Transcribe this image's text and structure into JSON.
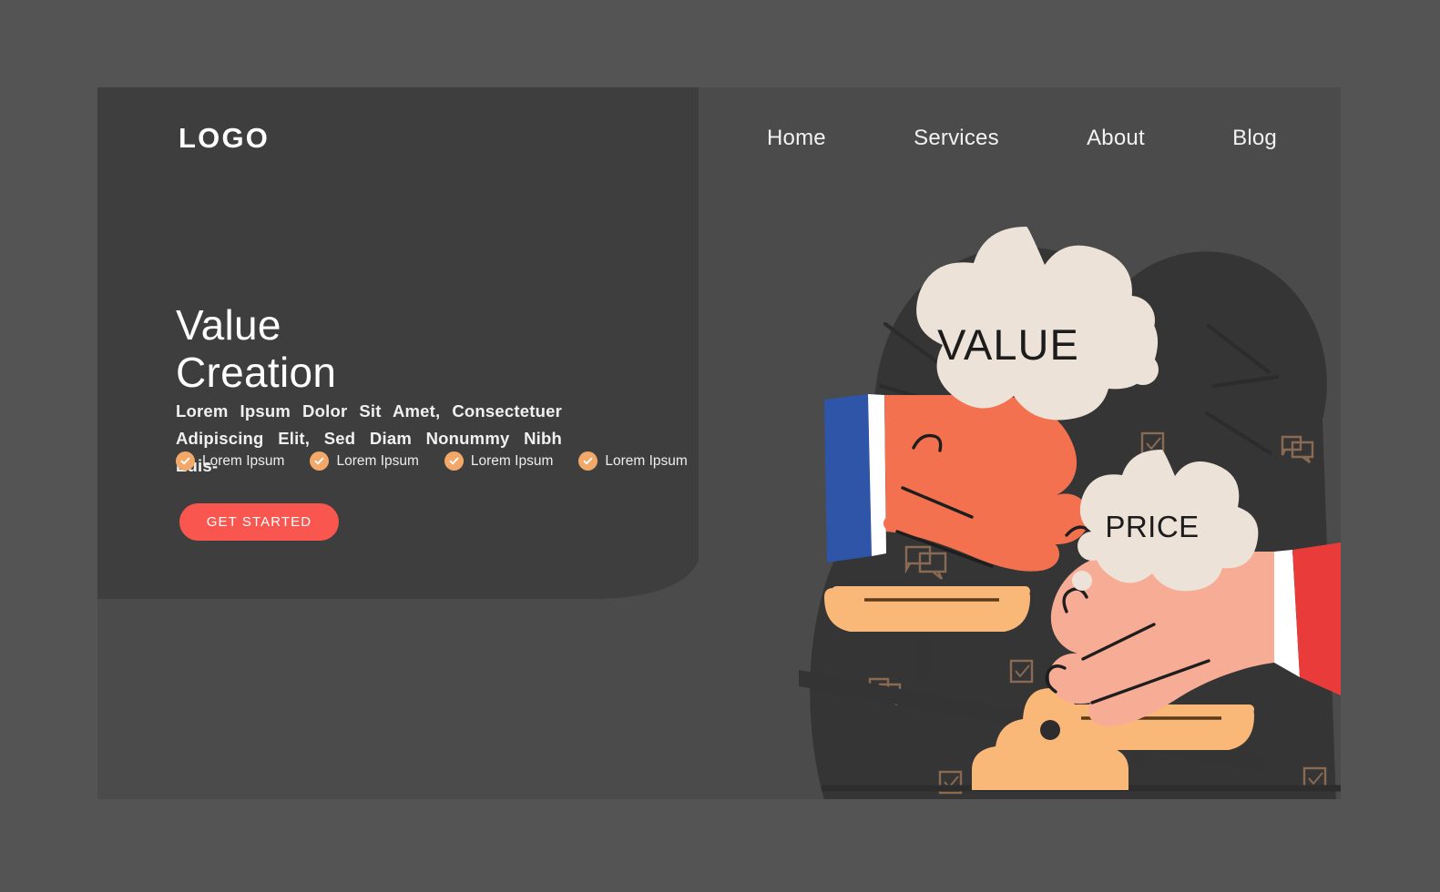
{
  "page": {
    "background_outer": "#545454",
    "card_background": "#3e3e3e"
  },
  "header": {
    "logo": "LOGO",
    "nav": [
      {
        "label": "Home"
      },
      {
        "label": "Services"
      },
      {
        "label": "About"
      },
      {
        "label": "Blog"
      }
    ]
  },
  "hero": {
    "headline_line1": "Value",
    "headline_line2": "Creation",
    "subcopy": "Lorem Ipsum Dolor Sit Amet, Consectetuer Adipiscing Elit, Sed Diam Nonummy Nibh Euis-",
    "features": [
      {
        "label": "Lorem Ipsum",
        "icon": "check-circle-icon"
      },
      {
        "label": "Lorem Ipsum",
        "icon": "check-circle-icon"
      },
      {
        "label": "Lorem Ipsum",
        "icon": "check-circle-icon"
      },
      {
        "label": "Lorem Ipsum",
        "icon": "check-circle-icon"
      }
    ],
    "cta_label": "GET STARTED"
  },
  "illustration": {
    "name": "value-vs-price-balance-scale",
    "value_bubble_text": "VALUE",
    "price_bubble_text": "PRICE",
    "colors": {
      "bubble": "#ece2d8",
      "hand_value": "#f4714f",
      "hand_price": "#f7ad95",
      "sleeve_value": "#2f55a8",
      "sleeve_price": "#ea3b3b",
      "cuff": "#ffffff",
      "scale_pan": "#f9b878",
      "scale_beam": "#343434",
      "accent_outline": "#8a6a52",
      "blob": "#353535"
    }
  }
}
